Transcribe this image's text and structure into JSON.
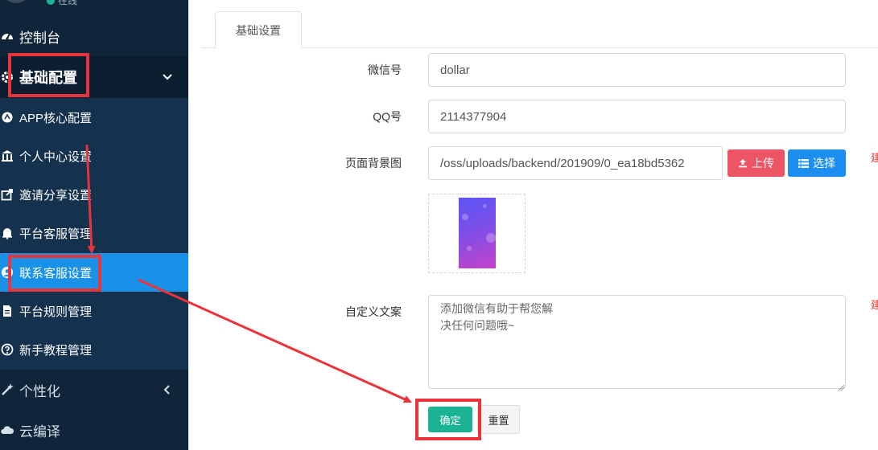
{
  "sidebar": {
    "user_status": "在线",
    "top_item": {
      "label": "控制台",
      "icon": "dashboard-icon"
    },
    "group": {
      "label": "基础配置",
      "icon": "gear-icon"
    },
    "items": [
      {
        "label": "APP核心配置",
        "icon": "app-icon"
      },
      {
        "label": "个人中心设置",
        "icon": "bank-icon"
      },
      {
        "label": "邀请分享设置",
        "icon": "share-icon"
      },
      {
        "label": "平台客服管理",
        "icon": "bell-icon"
      },
      {
        "label": "联系客服设置",
        "icon": "user-circle-icon",
        "active": true
      },
      {
        "label": "平台规则管理",
        "icon": "file-icon"
      },
      {
        "label": "新手教程管理",
        "icon": "question-icon"
      }
    ],
    "bottom_items": [
      {
        "label": "个性化",
        "icon": "magic-wand-icon"
      },
      {
        "label": "云编译",
        "icon": "cloud-icon"
      }
    ]
  },
  "main": {
    "tab": "基础设置",
    "form": {
      "wechat": {
        "label": "微信号",
        "value": "dollar"
      },
      "qq": {
        "label": "QQ号",
        "value": "2114377904"
      },
      "bg_image": {
        "label": "页面背景图",
        "value": "/oss/uploads/backend/201909/0_ea18bd5362",
        "upload_label": "上传",
        "select_label": "选择"
      },
      "custom_text": {
        "label": "自定义文案",
        "value": "添加微信有助于帮您解\n决任何问题哦~"
      },
      "side_hint": "建"
    },
    "actions": {
      "ok_label": "确定",
      "reset_label": "重置"
    }
  },
  "colors": {
    "sidebar_bg": "#10253a",
    "submenu_bg": "#14314e",
    "active_item": "#1a91e8",
    "upload_btn": "#ed5565",
    "select_btn": "#1c8ef0",
    "ok_btn": "#1ab394",
    "annotation": "#e8343a"
  }
}
